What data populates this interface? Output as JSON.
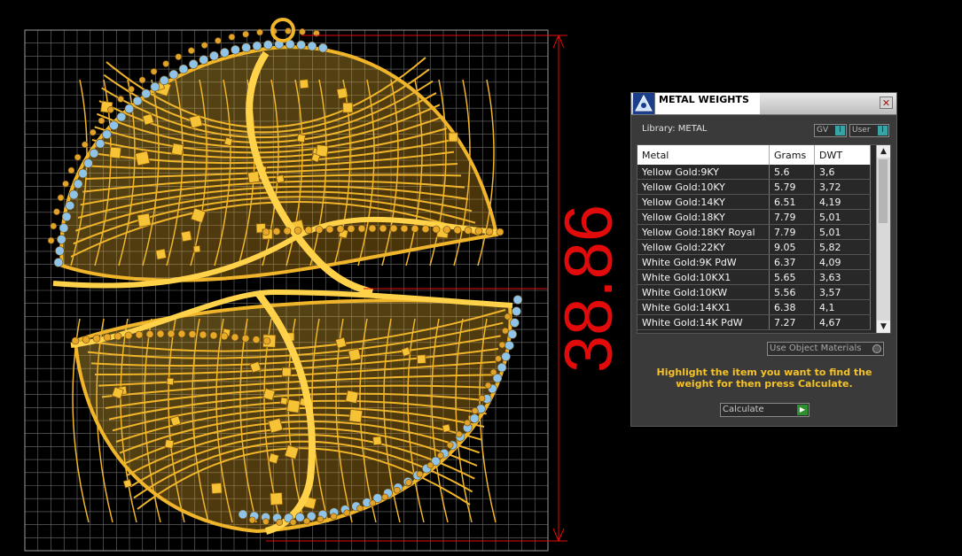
{
  "dimension": {
    "value": "38.86",
    "color": "#e10b0b"
  },
  "colors": {
    "gold": "#f0b52a",
    "gold_dark": "#8a5a0a",
    "stone": "#8fc4e8",
    "grid": "#6f6f6f"
  },
  "panel": {
    "title": "METAL WEIGHTS",
    "close_icon": "close-icon",
    "library_label": "Library: METAL",
    "gv_label": "GV",
    "user_label": "User",
    "toggle_mark": "I",
    "columns": [
      "Metal",
      "Grams",
      "DWT"
    ],
    "rows": [
      [
        "Yellow Gold:9KY",
        "5.6",
        "3,6"
      ],
      [
        "Yellow Gold:10KY",
        "5.79",
        "3,72"
      ],
      [
        "Yellow Gold:14KY",
        "6.51",
        "4,19"
      ],
      [
        "Yellow Gold:18KY",
        "7.79",
        "5,01"
      ],
      [
        "Yellow Gold:18KY Royal",
        "7.79",
        "5,01"
      ],
      [
        "Yellow Gold:22KY",
        "9.05",
        "5,82"
      ],
      [
        "White Gold:9K PdW",
        "6.37",
        "4,09"
      ],
      [
        "White Gold:10KX1",
        "5.65",
        "3,63"
      ],
      [
        "White Gold:10KW",
        "5.56",
        "3,57"
      ],
      [
        "White Gold:14KX1",
        "6.38",
        "4,1"
      ],
      [
        "White Gold:14K PdW",
        "7.27",
        "4,67"
      ]
    ],
    "use_materials_label": "Use Object Materials",
    "hint": "Highlight the item you want to find the weight for then press Calculate.",
    "calculate_label": "Calculate"
  }
}
